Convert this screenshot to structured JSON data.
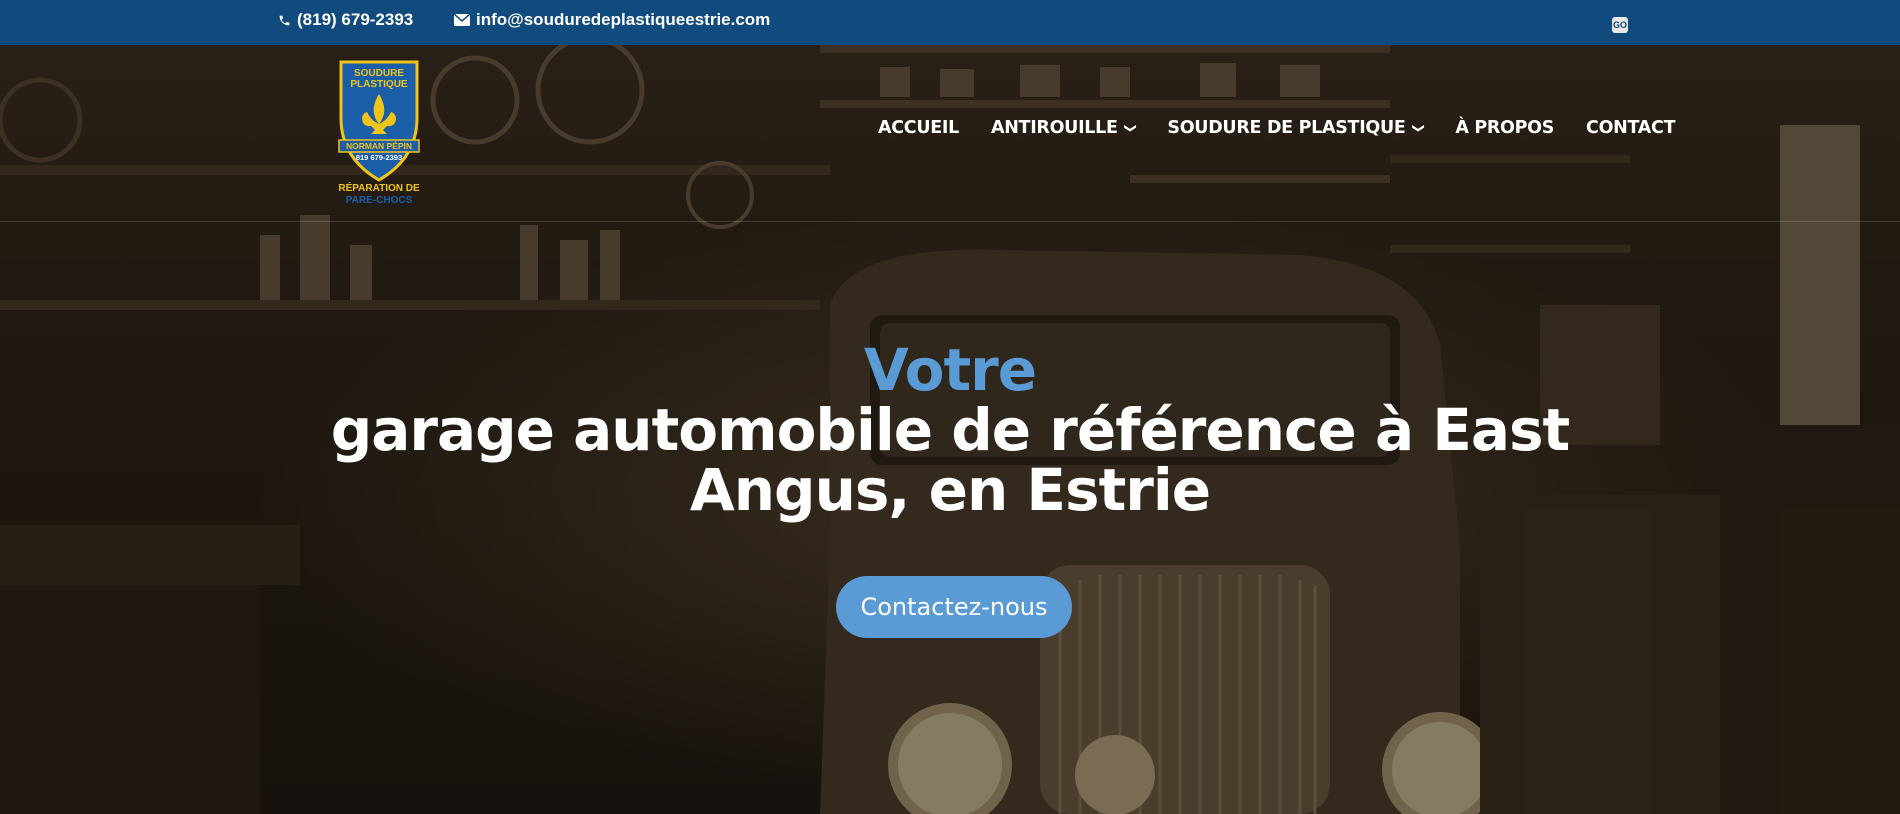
{
  "topbar": {
    "phone": "(819) 679-2393",
    "email": "info@souduredeplastiqueestrie.com",
    "social_label": "GO"
  },
  "logo": {
    "line1": "SOUDURE",
    "line2": "PLASTIQUE",
    "name": "NORMAN PÉPIN",
    "phone": "819 679-2393",
    "caption1": "RÉPARATION DE",
    "caption2": "PARE-CHOCS"
  },
  "nav": {
    "items": [
      {
        "label": "ACCUEIL",
        "has_dropdown": false
      },
      {
        "label": "ANTIROUILLE",
        "has_dropdown": true
      },
      {
        "label": "SOUDURE DE PLASTIQUE",
        "has_dropdown": true
      },
      {
        "label": "À PROPOS",
        "has_dropdown": false
      },
      {
        "label": "CONTACT",
        "has_dropdown": false
      }
    ]
  },
  "hero": {
    "accent": "Votre",
    "headline": "garage automobile de référence à East Angus, en Estrie",
    "cta_label": "Contactez-nous"
  },
  "colors": {
    "topbar": "#114a7c",
    "accent": "#5b9bd5"
  }
}
